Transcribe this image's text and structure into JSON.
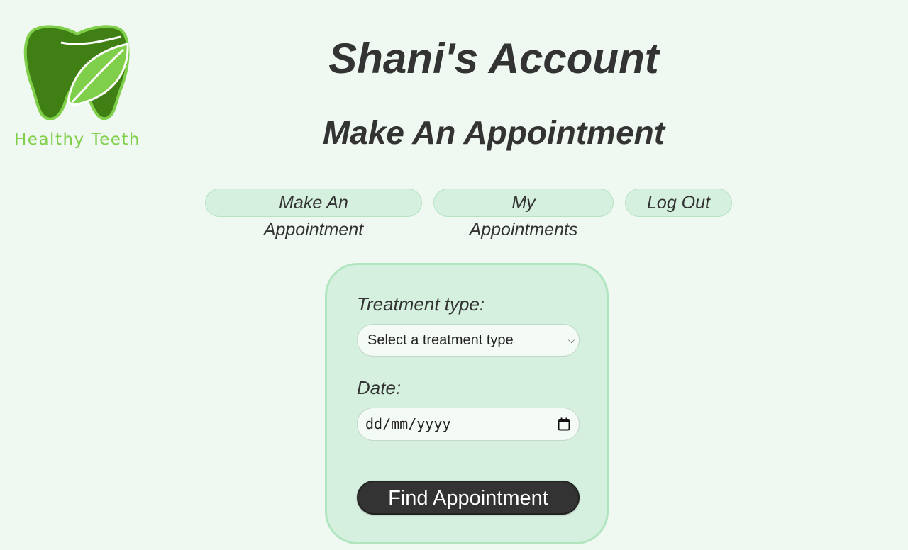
{
  "brand": {
    "name": "Healthy Teeth",
    "logo_icon": "tooth-leaf-icon",
    "color": "#7fcf4a"
  },
  "header": {
    "account_title": "Shani's Account",
    "page_title": "Make An Appointment"
  },
  "nav": {
    "items": [
      {
        "label": "Make An Appointment"
      },
      {
        "label": "My Appointments"
      },
      {
        "label": "Log Out"
      }
    ]
  },
  "form": {
    "treatment_label": "Treatment type:",
    "treatment_value": "Select a treatment type",
    "date_label": "Date:",
    "date_value": "dd/mm/yyyy",
    "submit_label": "Find Appointment"
  },
  "colors": {
    "background": "#eff9f1",
    "card": "#d5f0de",
    "primary_button": "#333333",
    "logo_dark": "#3f7f14",
    "logo_light": "#7fcf4a"
  }
}
